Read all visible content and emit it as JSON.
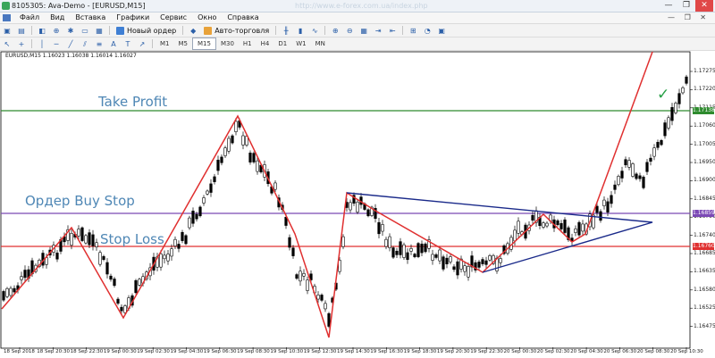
{
  "window": {
    "title": "8105305: Ava-Demo - [EURUSD,M15]",
    "ghost_url": "http://www.e-forex.com.ua/index.php",
    "controls": [
      "—",
      "❐",
      "✕"
    ]
  },
  "menu": {
    "items": [
      "Файл",
      "Вид",
      "Вставка",
      "Графики",
      "Сервис",
      "Окно",
      "Справка"
    ],
    "right_controls": "— ❐ ✕"
  },
  "toolbar": {
    "new_order_label": "Новый ордер",
    "autotrading_label": "Авто-торговля",
    "timeframes": [
      "M1",
      "M5",
      "M15",
      "M30",
      "H1",
      "H4",
      "D1",
      "W1",
      "MN"
    ],
    "active_timeframe": "M15",
    "icons_row1": [
      "new-chart-icon",
      "profiles-icon",
      "market-watch-icon",
      "data-window-icon",
      "navigator-icon",
      "terminal-icon",
      "tester-icon",
      "metaeditor-icon",
      "zoom-in-icon",
      "zoom-out-icon",
      "tile-icon",
      "scroll-icon",
      "shift-icon",
      "indicators-icon",
      "periods-icon",
      "templates-icon"
    ],
    "icons_row2": [
      "cursor-icon",
      "crosshair-icon",
      "vertical-line-icon",
      "horizontal-line-icon",
      "trendline-icon",
      "channel-icon",
      "fibonacci-icon",
      "text-icon",
      "label-icon",
      "arrow-icon"
    ]
  },
  "chart": {
    "symbol_info": "EURUSD,M15  1.16023 1.16038 1.16014 1.16027",
    "annotations": {
      "take_profit": "Take Profit",
      "buy_stop": "Ордер Buy Stop",
      "stop_loss": "Stop Loss"
    },
    "price_ticks": [
      "1.17275",
      "1.17220",
      "1.17115",
      "1.17060",
      "1.17005",
      "1.16950",
      "1.16900",
      "1.16845",
      "1.16790",
      "1.16740",
      "1.16685",
      "1.16635",
      "1.16580",
      "1.16525",
      "1.16475"
    ],
    "price_badges": [
      {
        "value": "1.17138",
        "color": "#2e8b2e"
      },
      {
        "value": "1.16859",
        "color": "#7b49b5"
      },
      {
        "value": "1.16760",
        "color": "#e03030"
      }
    ],
    "time_ticks": [
      "18 Sep 2018",
      "18 Sep 20:30",
      "18 Sep 22:30",
      "19 Sep 00:30",
      "19 Sep 02:30",
      "19 Sep 04:30",
      "19 Sep 06:30",
      "19 Sep 08:30",
      "19 Sep 10:30",
      "19 Sep 12:30",
      "19 Sep 14:30",
      "19 Sep 16:30",
      "19 Sep 18:30",
      "19 Sep 20:30",
      "19 Sep 22:30",
      "20 Sep 00:30",
      "20 Sep 02:30",
      "20 Sep 04:30",
      "20 Sep 06:30",
      "20 Sep 08:30",
      "20 Sep 10:30"
    ],
    "colors": {
      "take_profit_line": "#2e8b2e",
      "buy_stop_line": "#7b49b5",
      "stop_loss_line": "#e03030",
      "zigzag": "#e03030",
      "triangle": "#1a2a8a",
      "candles": "#000000"
    }
  }
}
